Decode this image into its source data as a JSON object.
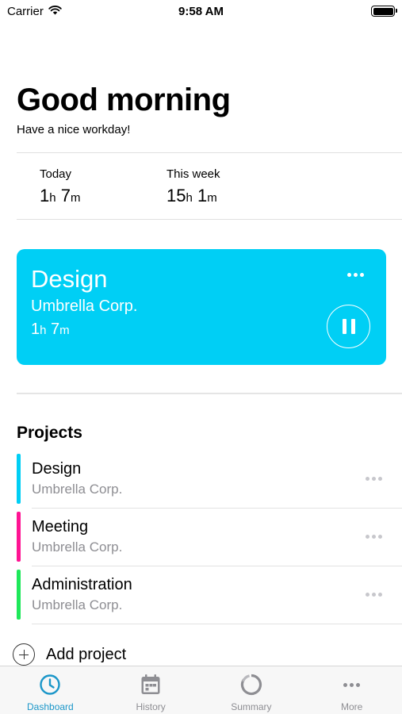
{
  "status_bar": {
    "carrier": "Carrier",
    "time": "9:58 AM",
    "wifi_icon": "wifi-icon",
    "battery_icon": "battery-icon"
  },
  "header": {
    "greeting": "Good morning",
    "subtitle": "Have a nice workday!"
  },
  "stats": {
    "today": {
      "label": "Today",
      "hours": "1",
      "h_unit": "h",
      "minutes": "7",
      "m_unit": "m"
    },
    "week": {
      "label": "This week",
      "hours": "15",
      "h_unit": "h",
      "minutes": "1",
      "m_unit": "m"
    }
  },
  "active_timer": {
    "project": "Design",
    "client": "Umbrella Corp.",
    "hours": "1",
    "h_unit": "h",
    "minutes": "7",
    "m_unit": "m",
    "color": "#00cff5",
    "more_icon": "more-icon",
    "pause_icon": "pause-icon"
  },
  "projects": {
    "title": "Projects",
    "items": [
      {
        "name": "Design",
        "client": "Umbrella Corp.",
        "color": "#00cff5"
      },
      {
        "name": "Meeting",
        "client": "Umbrella Corp.",
        "color": "#ff1493"
      },
      {
        "name": "Administration",
        "client": "Umbrella Corp.",
        "color": "#1ee85a"
      }
    ],
    "add_label": "Add project"
  },
  "tab_bar": {
    "tabs": [
      {
        "label": "Dashboard",
        "icon": "clock-icon",
        "active": true
      },
      {
        "label": "History",
        "icon": "calendar-icon",
        "active": false
      },
      {
        "label": "Summary",
        "icon": "progress-ring-icon",
        "active": false
      },
      {
        "label": "More",
        "icon": "more-icon",
        "active": false
      }
    ],
    "active_color": "#1c97c9",
    "inactive_color": "#8e8e93"
  }
}
